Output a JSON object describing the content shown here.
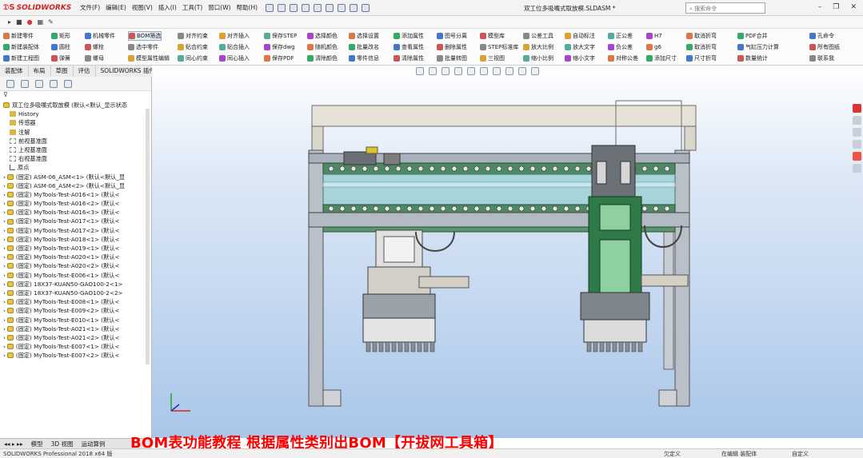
{
  "titlebar": {
    "app_name": "SOLIDWORKS",
    "menus": [
      "文件(F)",
      "编辑(E)",
      "视图(V)",
      "插入(I)",
      "工具(T)",
      "窗口(W)",
      "帮助(H)"
    ],
    "document_title": "双工位多吸嘴式取放模.SLDASM *",
    "search_placeholder": "搜索命令"
  },
  "ribbon": {
    "row1": [
      "新建零件",
      "矩形",
      "机械零件",
      "BOM筛选",
      "对齐约束",
      "对齐插入",
      "保存STEP",
      "选择颜色",
      "选择设置",
      "添加属性",
      "图号分离",
      "模型库",
      "公差工具",
      "自动标注",
      "正公差",
      "H7",
      "取消折弯",
      "PDF合并",
      "孔命令"
    ],
    "row2": [
      "新建装配体",
      "圆柱",
      "螺栓",
      "选中零件",
      "贴合约束",
      "贴合插入",
      "保存dwg",
      "随机颜色",
      "批量改名",
      "查看属性",
      "删除属性",
      "STEP标准库",
      "放大比例",
      "放大文字",
      "负公差",
      "g6",
      "取消折弯",
      "气缸压力计算",
      "所有图纸"
    ],
    "row3": [
      "新建工程图",
      "弹簧",
      "螺母",
      "模型属性编辑",
      "同心约束",
      "同心插入",
      "保存PDF",
      "清除颜色",
      "零件信息",
      "清除属性",
      "批量转图",
      "三视图",
      "缩小比例",
      "缩小文字",
      "对称公差",
      "添加尺寸",
      "尺寸折弯",
      "数量统计",
      "联系我"
    ]
  },
  "tabs": [
    "装配体",
    "布局",
    "草图",
    "评估",
    "SOLIDWORKS 插件"
  ],
  "tree": {
    "root": "双工位多吸嘴式取放模 (默认<默认_显示状态",
    "items": [
      "History",
      "传感器",
      "注解",
      "前视基准面",
      "上视基准面",
      "右视基准面",
      "原点",
      "(固定) ASM-06_ASM<1> (默认<默认_显",
      "(固定) ASM-06_ASM<2> (默认<默认_显",
      "(固定) MyTools-Test-A016<1> (默认<",
      "(固定) MyTools-Test-A016<2> (默认<",
      "(固定) MyTools-Test-A016<3> (默认<",
      "(固定) MyTools-Test-A017<1> (默认<",
      "(固定) MyTools-Test-A017<2> (默认<",
      "(固定) MyTools-Test-A018<1> (默认<",
      "(固定) MyTools-Test-A019<1> (默认<",
      "(固定) MyTools-Test-A020<1> (默认<",
      "(固定) MyTools-Test-A020<2> (默认<",
      "(固定) MyTools-Test-E006<1> (默认<",
      "(固定) 18X37-KUAN50-GAO100-2<1>",
      "(固定) 18X37-KUAN50-GAO100-2<2>",
      "(固定) MyTools-Test-E008<1> (默认<",
      "(固定) MyTools-Test-E009<2> (默认<",
      "(固定) MyTools-Test-E010<1> (默认<",
      "(固定) MyTools-Test-A021<1> (默认<",
      "(固定) MyTools-Test-A021<2> (默认<",
      "(固定) MyTools-Test-E007<1> (默认<",
      "(固定) MyTools-Test-E007<2> (默认<"
    ]
  },
  "bottom_tabs": [
    "模型",
    "3D 视图",
    "运动算例"
  ],
  "caption": "BOM表功能教程    根据属性类别出BOM【开拔网工具箱】",
  "status": {
    "left": "SOLIDWORKS Professional 2018 x64 版",
    "mid1": "欠定义",
    "mid2": "在编辑 装配体",
    "right": "自定义"
  },
  "colors": {
    "viewport_top": "#ffffff",
    "viewport_bottom": "#a9c6ea",
    "caption": "#ff0000",
    "frame_gray": "#8a95a3",
    "rail_green": "#4a8a62",
    "rail_teal": "#9fd0d8",
    "head_green": "#2f7a48"
  },
  "icons": [
    "search-icon",
    "home-icon",
    "new-icon",
    "open-icon",
    "save-icon",
    "print-icon",
    "undo-icon",
    "select-icon",
    "rebuild-icon",
    "options-icon",
    "filter-icon",
    "axis-triad-icon"
  ]
}
